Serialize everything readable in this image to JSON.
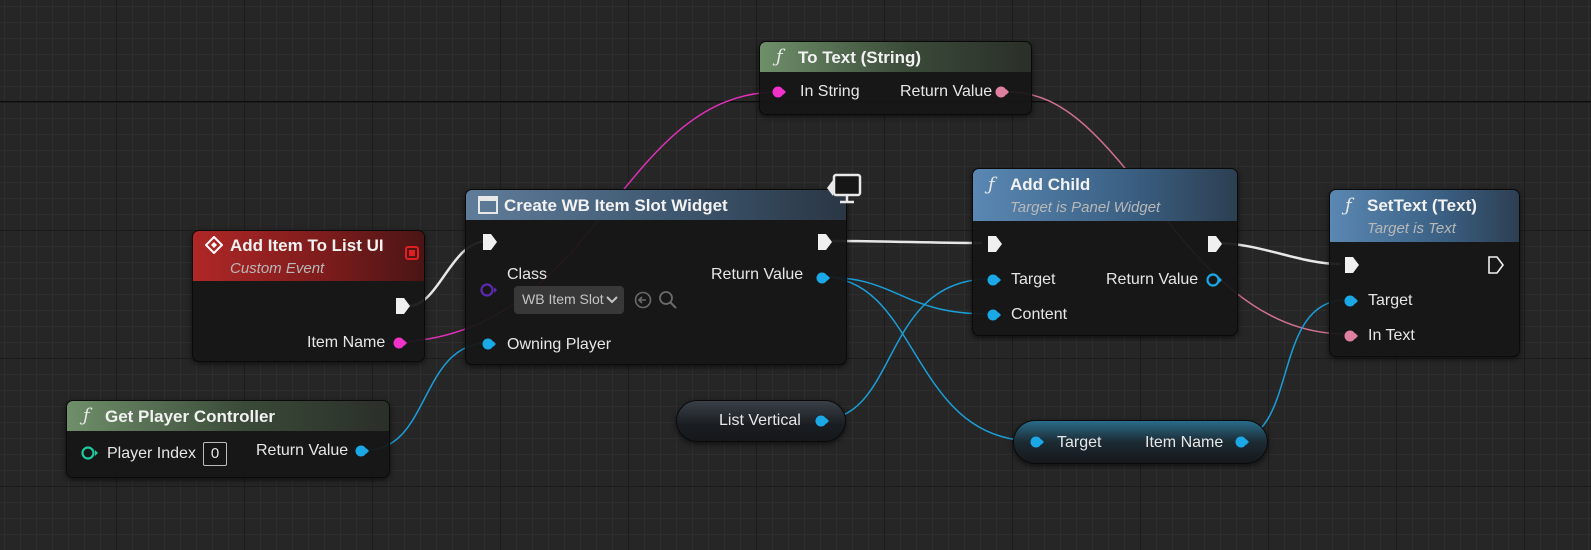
{
  "graph": {
    "colors": {
      "exec_wire": "#e8e8e8",
      "string_pin": "#f032c8",
      "text_pin": "#e080a0",
      "object_pin": "#1aa8e6",
      "class_pin": "#5b2ab0",
      "int_pin": "#1fc9a0"
    },
    "icons": {
      "function": "function-icon",
      "event": "event-diamond-icon",
      "widget": "widget-icon",
      "monitor": "monitor-icon"
    }
  },
  "nodes": {
    "to_text": {
      "title": "To Text (String)",
      "in_string": "In String",
      "return_value": "Return Value"
    },
    "add_item_event": {
      "title": "Add Item To List UI",
      "subtitle": "Custom Event",
      "item_name": "Item Name"
    },
    "create_widget": {
      "title": "Create WB Item Slot Widget",
      "class_label": "Class",
      "class_value": "WB Item Slot",
      "return_value": "Return Value",
      "owning_player": "Owning Player"
    },
    "add_child": {
      "title": "Add Child",
      "subtitle": "Target is Panel Widget",
      "target": "Target",
      "content": "Content",
      "return_value": "Return Value"
    },
    "set_text": {
      "title": "SetText (Text)",
      "subtitle": "Target is Text",
      "target": "Target",
      "in_text": "In Text"
    },
    "get_player_controller": {
      "title": "Get Player Controller",
      "player_index": "Player Index",
      "player_index_value": "0",
      "return_value": "Return Value"
    },
    "list_vertical": {
      "label": "List Vertical"
    },
    "item_name_getter": {
      "target": "Target",
      "item_name": "Item Name"
    }
  }
}
